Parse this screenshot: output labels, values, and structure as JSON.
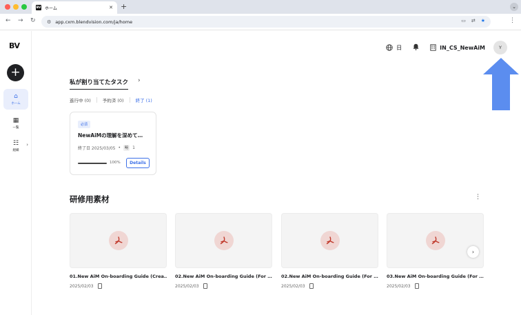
{
  "browser": {
    "tab_title": "ホーム",
    "tab_favicon_text": "BV",
    "url": "app.cxm.blendvision.com/ja/home"
  },
  "sidebar": {
    "logo": "BV",
    "add_label": "+",
    "items": [
      {
        "label": "ホーム",
        "icon": "home-icon",
        "active": true
      },
      {
        "label": "一覧",
        "icon": "grid-icon",
        "active": false
      },
      {
        "label": "組織",
        "icon": "organization-icon",
        "active": false
      }
    ]
  },
  "header": {
    "language": "日",
    "org_name": "IN_CS_NewAiM",
    "avatar_initial": "Y"
  },
  "tasks": {
    "title": "私が割り当てたタスク",
    "filters": [
      {
        "label": "進行中 (0)",
        "selected": false
      },
      {
        "label": "予約済 (0)",
        "selected": false
      },
      {
        "label": "終了 (1)",
        "selected": true
      }
    ],
    "card": {
      "badge": "必須",
      "title": "NewAiMの理解を深めて…",
      "due": "終了日 2025/03/05",
      "bullet": "•",
      "chip": "明",
      "count": "1",
      "progress": 100,
      "progress_label": "100%",
      "details_label": "Details"
    }
  },
  "materials": {
    "title": "研修用素材",
    "items": [
      {
        "title": "01.New AiM On-boarding Guide (Crea…",
        "date": "2025/02/03"
      },
      {
        "title": "02.New AiM On-boarding Guide (For …",
        "date": "2025/02/03"
      },
      {
        "title": "02.New AiM On-boarding Guide (For …",
        "date": "2025/02/03"
      },
      {
        "title": "03.New AiM On-boarding Guide (For …",
        "date": "2025/02/03"
      }
    ]
  },
  "colors": {
    "accent": "#3b6fe8",
    "annotation_arrow": "#5b8def",
    "pdf_icon": "#c0392b"
  }
}
